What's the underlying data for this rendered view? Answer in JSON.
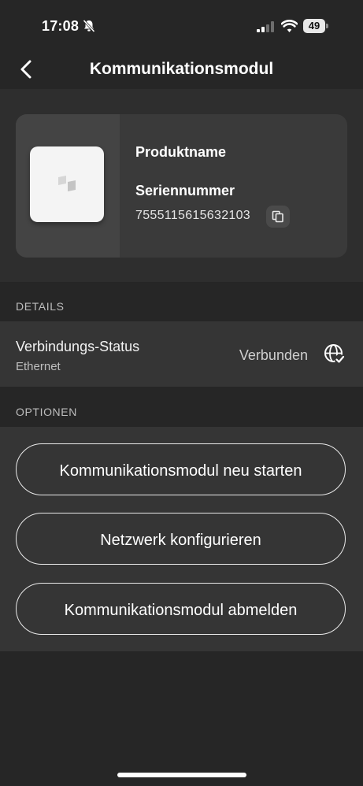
{
  "status_bar": {
    "time": "17:08",
    "battery": "49"
  },
  "nav": {
    "title": "Kommunikationsmodul"
  },
  "product": {
    "name_label": "Produktname",
    "serial_label": "Seriennummer",
    "serial_value": "7555115615632103"
  },
  "details": {
    "section_label": "DETAILS",
    "connection_title": "Verbindungs-Status",
    "connection_type": "Ethernet",
    "connection_value": "Verbunden"
  },
  "options": {
    "section_label": "OPTIONEN",
    "restart_label": "Kommunikationsmodul neu starten",
    "configure_label": "Netzwerk konfigurieren",
    "logout_label": "Kommunikationsmodul abmelden"
  },
  "icons": {
    "back": "chevron-left-icon",
    "copy": "copy-icon",
    "network": "globe-check-icon",
    "mute": "bell-slash-icon"
  },
  "colors": {
    "background": "#262626",
    "card": "#3a3a3a",
    "row": "#353535",
    "text": "#ffffff"
  }
}
